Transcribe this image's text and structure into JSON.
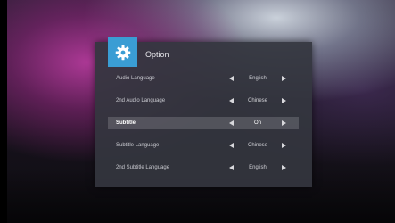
{
  "dialog": {
    "title": "Option",
    "icon": "gear-icon",
    "accent_color": "#3a9dd4"
  },
  "rows": [
    {
      "label": "Audio Language",
      "value": "English"
    },
    {
      "label": "2nd Audio Language",
      "value": "Chinese"
    },
    {
      "label": "Subtitle",
      "value": "On",
      "selected": true
    },
    {
      "label": "Subtitle Language",
      "value": "Chinese"
    },
    {
      "label": "2nd Subtitle Language",
      "value": "English"
    }
  ]
}
